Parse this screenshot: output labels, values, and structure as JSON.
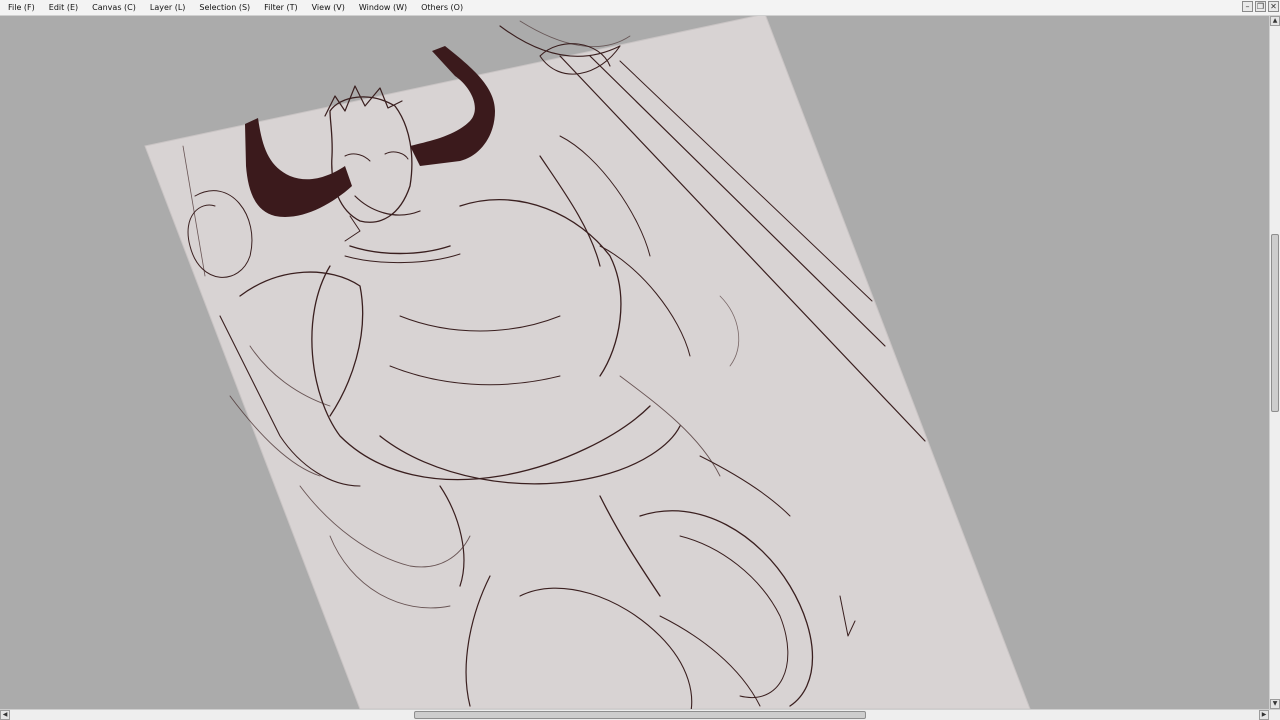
{
  "menubar": {
    "items": [
      {
        "label": "File (F)"
      },
      {
        "label": "Edit (E)"
      },
      {
        "label": "Canvas (C)"
      },
      {
        "label": "Layer (L)"
      },
      {
        "label": "Selection (S)"
      },
      {
        "label": "Filter (T)"
      },
      {
        "label": "View (V)"
      },
      {
        "label": "Window (W)"
      },
      {
        "label": "Others (O)"
      }
    ]
  },
  "window_controls": {
    "minimize_glyph": "–",
    "restore_glyph": "❐",
    "close_glyph": "✕"
  },
  "colors": {
    "workspace_bg": "#ababab",
    "paper": "#d8d3d3",
    "ink": "#3a1f1f",
    "horn": "#3b1a1c"
  },
  "scrollbars": {
    "vertical": {
      "up_glyph": "▲",
      "down_glyph": "▼"
    },
    "horizontal": {
      "left_glyph": "◀",
      "right_glyph": "▶"
    }
  }
}
